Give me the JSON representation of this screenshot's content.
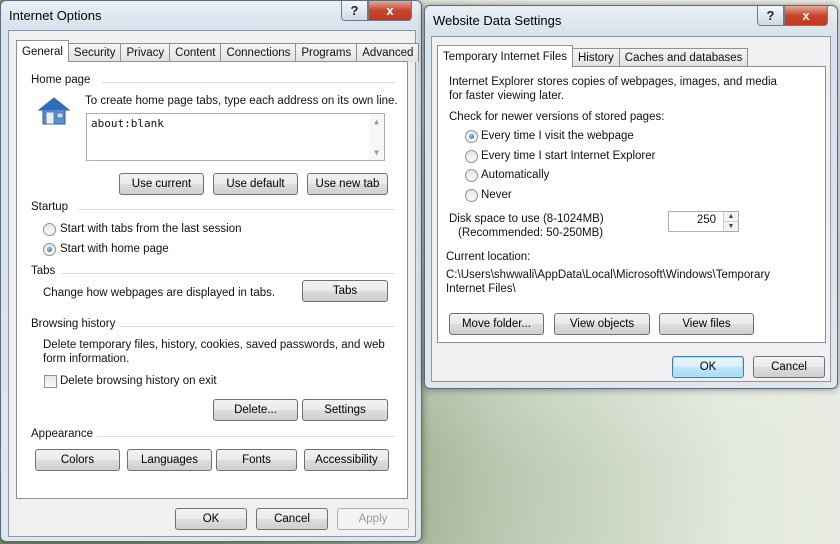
{
  "internet_options": {
    "title": "Internet Options",
    "title_help": "?",
    "title_close": "x",
    "tabs": [
      "General",
      "Security",
      "Privacy",
      "Content",
      "Connections",
      "Programs",
      "Advanced"
    ],
    "home_page": {
      "group_label": "Home page",
      "instruction": "To create home page tabs, type each address on its own line.",
      "value": "about:blank",
      "use_current": "Use current",
      "use_default": "Use default",
      "use_new_tab": "Use new tab"
    },
    "startup": {
      "group_label": "Startup",
      "option_last_session": "Start with tabs from the last session",
      "option_home_page": "Start with home page"
    },
    "tabs_group": {
      "group_label": "Tabs",
      "description": "Change how webpages are displayed in tabs.",
      "tabs_button": "Tabs"
    },
    "browsing_history": {
      "group_label": "Browsing history",
      "description_line1": "Delete temporary files, history, cookies, saved passwords, and web",
      "description_line2": "form information.",
      "delete_on_exit": "Delete browsing history on exit",
      "delete_button": "Delete...",
      "settings_button": "Settings"
    },
    "appearance": {
      "group_label": "Appearance",
      "colors": "Colors",
      "languages": "Languages",
      "fonts": "Fonts",
      "accessibility": "Accessibility"
    },
    "footer": {
      "ok": "OK",
      "cancel": "Cancel",
      "apply": "Apply"
    }
  },
  "website_data_settings": {
    "title": "Website Data Settings",
    "title_help": "?",
    "title_close": "x",
    "tabs": [
      "Temporary Internet Files",
      "History",
      "Caches and databases"
    ],
    "intro_line1": "Internet Explorer stores copies of webpages, images, and media",
    "intro_line2": "for faster viewing later.",
    "check_label": "Check for newer versions of stored pages:",
    "options": [
      "Every time I visit the webpage",
      "Every time I start Internet Explorer",
      "Automatically",
      "Never"
    ],
    "disk_space_label": "Disk space to use (8-1024MB)",
    "disk_space_recommended": "(Recommended: 50-250MB)",
    "disk_space_value": "250",
    "current_location_label": "Current location:",
    "location_line1": "C:\\Users\\shwwali\\AppData\\Local\\Microsoft\\Windows\\Temporary",
    "location_line2": "Internet Files\\",
    "move_folder": "Move folder...",
    "view_objects": "View objects",
    "view_files": "View files",
    "ok": "OK",
    "cancel": "Cancel"
  },
  "colors": {
    "accent": "#3c7fb1",
    "close_button": "#c8442c",
    "group_line": "#d5dfe5"
  }
}
